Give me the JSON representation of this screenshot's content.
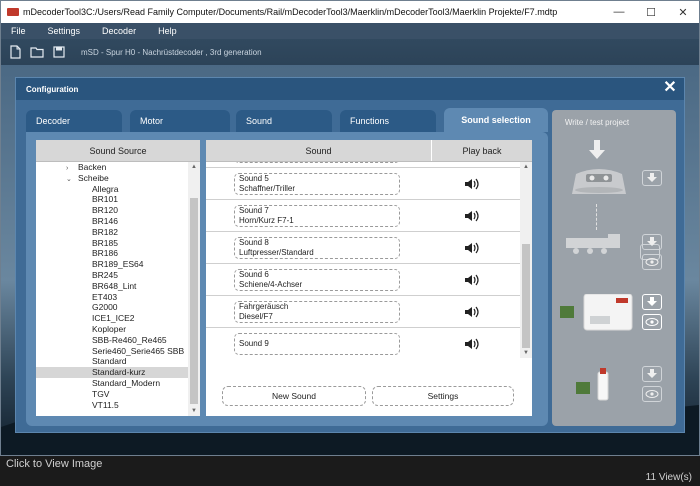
{
  "window": {
    "title": "mDecoderTool3C:/Users/Read Family Computer/Documents/Rail/mDecoderTool3/Maerklin/mDecoderTool3/Maerklin Projekte/F7.mdtp",
    "minimize": "—",
    "maximize": "☐",
    "close": "✕"
  },
  "menu": [
    "File",
    "Settings",
    "Decoder",
    "Help"
  ],
  "toolbar": {
    "decoder_info": "mSD - Spur H0 - Nachrüstdecoder , 3rd generation"
  },
  "dialog": {
    "title": "Configuration",
    "close": "✕"
  },
  "tabs": [
    {
      "label": "Decoder",
      "active": false
    },
    {
      "label": "Motor",
      "active": false
    },
    {
      "label": "Sound",
      "active": false
    },
    {
      "label": "Functions",
      "active": false
    },
    {
      "label": "Sound selection",
      "active": true
    }
  ],
  "sound_source": {
    "header": "Sound Source",
    "tree": [
      {
        "label": "Backen",
        "level": 1,
        "arrow": "›"
      },
      {
        "label": "Scheibe",
        "level": 1,
        "arrow": "⌄"
      },
      {
        "label": "Allegra",
        "level": 2
      },
      {
        "label": "BR101",
        "level": 2
      },
      {
        "label": "BR120",
        "level": 2
      },
      {
        "label": "BR146",
        "level": 2
      },
      {
        "label": "BR182",
        "level": 2
      },
      {
        "label": "BR185",
        "level": 2
      },
      {
        "label": "BR186",
        "level": 2
      },
      {
        "label": "BR189_ES64",
        "level": 2
      },
      {
        "label": "BR245",
        "level": 2
      },
      {
        "label": "BR648_Lint",
        "level": 2
      },
      {
        "label": "ET403",
        "level": 2
      },
      {
        "label": "G2000",
        "level": 2
      },
      {
        "label": "ICE1_ICE2",
        "level": 2
      },
      {
        "label": "Koploper",
        "level": 2
      },
      {
        "label": "SBB-Re460_Re465",
        "level": 2
      },
      {
        "label": "Serie460_Serie465 SBB",
        "level": 2
      },
      {
        "label": "Standard",
        "level": 2
      },
      {
        "label": "Standard-kurz",
        "level": 2,
        "selected": true
      },
      {
        "label": "Standard_Modern",
        "level": 2
      },
      {
        "label": "TGV",
        "level": 2
      },
      {
        "label": "VT11.5",
        "level": 2
      }
    ]
  },
  "sounds": {
    "header_sound": "Sound",
    "header_playback": "Play back",
    "rows": [
      {
        "line1": "Sound 5",
        "line2": "Schaffner/Triller"
      },
      {
        "line1": "Sound 7",
        "line2": "Horn/Kurz F7-1"
      },
      {
        "line1": "Sound 8",
        "line2": "Luftpresser/Standard"
      },
      {
        "line1": "Sound 6",
        "line2": "Schiene/4-Achser"
      },
      {
        "line1": "Fahrgeräusch",
        "line2": "Diesel/F7"
      },
      {
        "line1": "Sound 9",
        "line2": ""
      }
    ],
    "new_sound": "New Sound",
    "settings": "Settings"
  },
  "side": {
    "title": "Write / test project"
  },
  "status": {
    "left": "Click to View Image",
    "right": "11 View(s)"
  },
  "colors": {
    "menubar": "#3a5067",
    "dialog": "#3f6b96",
    "dialog_header": "#2a557e",
    "tab_active": "#5e89b2",
    "tab_inactive": "#2c5a86",
    "side_panel": "#9ba2a9"
  }
}
